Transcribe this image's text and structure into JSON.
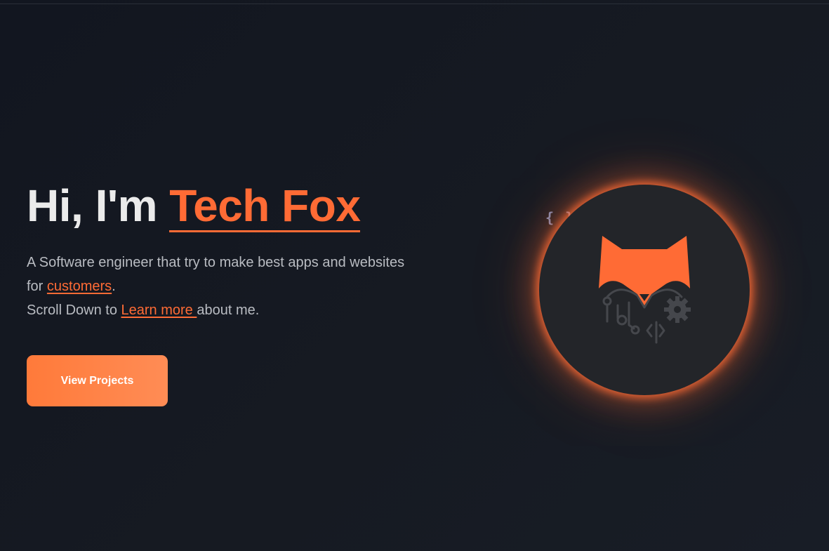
{
  "hero": {
    "greeting": "Hi, I'm ",
    "name": "Tech Fox",
    "subtitle": {
      "line1": "A Software engineer that try to make best apps and websites for ",
      "link1": "customers",
      "after_link1": ".",
      "line2_prefix": "Scroll Down to ",
      "link2": "Learn more ",
      "line2_suffix": "about me."
    },
    "cta_label": "View Projects"
  },
  "decor": {
    "braces": "{ }",
    "avatar_icon": "fox-circuit-logo-icon"
  },
  "colors": {
    "accent": "#ff6b35",
    "background": "#141820",
    "heading": "#ebebeb",
    "body_text": "#b9bcc2",
    "avatar_bg": "#232529",
    "braces": "#7b8db8"
  }
}
